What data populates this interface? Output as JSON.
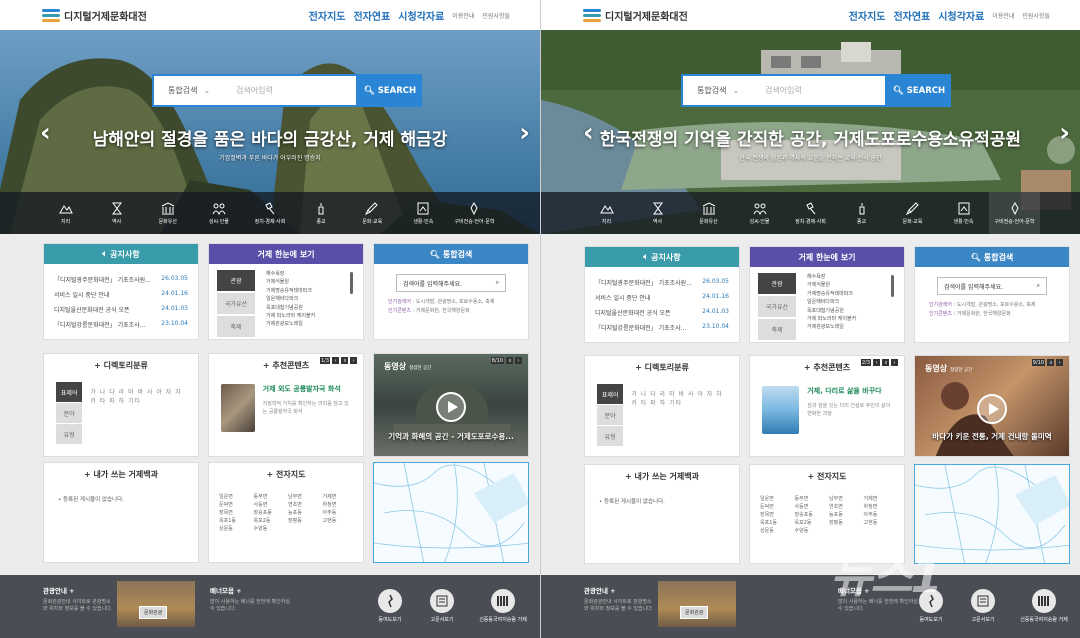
{
  "site": {
    "name": "디지털거제문화대전",
    "top_links": [
      "전자지도",
      "전자연표",
      "시청각자료"
    ],
    "util_links": [
      "이용안내",
      "민원사항들"
    ]
  },
  "search": {
    "select": "통합검색",
    "placeholder": "검색어입력",
    "button": "SEARCH"
  },
  "categories": [
    "지리",
    "역사",
    "문화유산",
    "성씨·인물",
    "정치·경제·사회",
    "종교",
    "문화·교육",
    "생활·민속",
    "구비전승·언어·문학"
  ],
  "left": {
    "headline": "남해안의 절경을 품은 바다의 금강산, 거제 해금강",
    "subline": "기암절벽과 푸른 바다가 어우러진 명승지"
  },
  "right": {
    "headline": "한국전쟁의 기억을 간직한 공간, 거제도포로수용소유적공원",
    "subline": "한국 전쟁의 상흔과 역사적 교훈을 전하는 교육·전시 공간"
  },
  "notice": {
    "title": "공지사항",
    "items": [
      {
        "t": "「디지털광주문화대전」 기초조사원...",
        "d": "26.03.05"
      },
      {
        "t": "서비스 일시 중단 안내",
        "d": "24.01.16"
      },
      {
        "t": "디지털울산문화대전 공식 오픈",
        "d": "24.01.03"
      },
      {
        "t": "「디지털강릉문화대전」 기초조사...",
        "d": "23.10.04"
      }
    ]
  },
  "glance": {
    "title": "거제 한눈에 보기",
    "tabs": [
      "관광",
      "국가유산",
      "축제"
    ],
    "items": [
      "해수욕장",
      "거제식물원",
      "거제명승유적테마파크",
      "일운해바다파크",
      "옥포대첩기념공원",
      "거제 파노라마 케이블카",
      "거제관광모노레일"
    ]
  },
  "isearch": {
    "title": "통합검색",
    "placeholder": "검색어를 입력해주세요.",
    "popular_label": "인기검색어",
    "popular": "도시개발, 관광명소, 포로수용소, 축제",
    "content_label": "인기콘텐츠",
    "content": "거제문화원, 한국해양문화"
  },
  "directory": {
    "title": "디렉토리분류",
    "tabs": [
      "표제어",
      "분야",
      "유형"
    ],
    "text": "가 나 다 라 마 바 사 아 자 차 카 타 파 하 기타"
  },
  "recommend": {
    "title": "추천콘텐츠",
    "left_page": "1/3",
    "left_title": "거제 외도 공룡발자국 화석",
    "left_desc": "지질학적 가치를 확인하는 의미를 담고 있는 공룡발자국 화석",
    "right_page": "2/3",
    "right_title": "거제, 다리로 삶을 바꾸다",
    "right_desc": "섬과 섬을 잇는 다리 건설로 주민의 삶이 변화한 과정"
  },
  "video": {
    "label": "동영상",
    "label_small": "청렴한 공간",
    "left_page": "8/10",
    "left_caption": "기억과 화해의 공간 - 거제도포로수용...",
    "right_page": "9/10",
    "right_caption": "바다가 키운 전통, 거제 건내랑 돌미역"
  },
  "encyc": {
    "title": "내가 쓰는 거제백과",
    "empty": "등록된 게시물이 없습니다."
  },
  "emap": {
    "title": "전자지도",
    "places": [
      "일운면",
      "동부면",
      "남부면",
      "거제면",
      "둔덕면",
      "사등면",
      "연초면",
      "하청면",
      "장목면",
      "장승포동",
      "능포동",
      "아주동",
      "옥포1동",
      "옥포2동",
      "장평동",
      "고현동",
      "상문동",
      "수양동"
    ]
  },
  "footer": {
    "tour_title": "관광안내",
    "tour_desc": "문화관광안내 사이트로 관광명소와 위치와 정보를 볼 수 있습니다.",
    "tour_btn": "문화관광",
    "banner_title": "배너모음",
    "banner_desc": "많이 사용하는 배너를 한번에 확인하실 수 있습니다.",
    "icons": [
      "동여도보기",
      "고문서보기",
      "신증동국여지승람 거제"
    ]
  },
  "watermark": "뉴스1"
}
